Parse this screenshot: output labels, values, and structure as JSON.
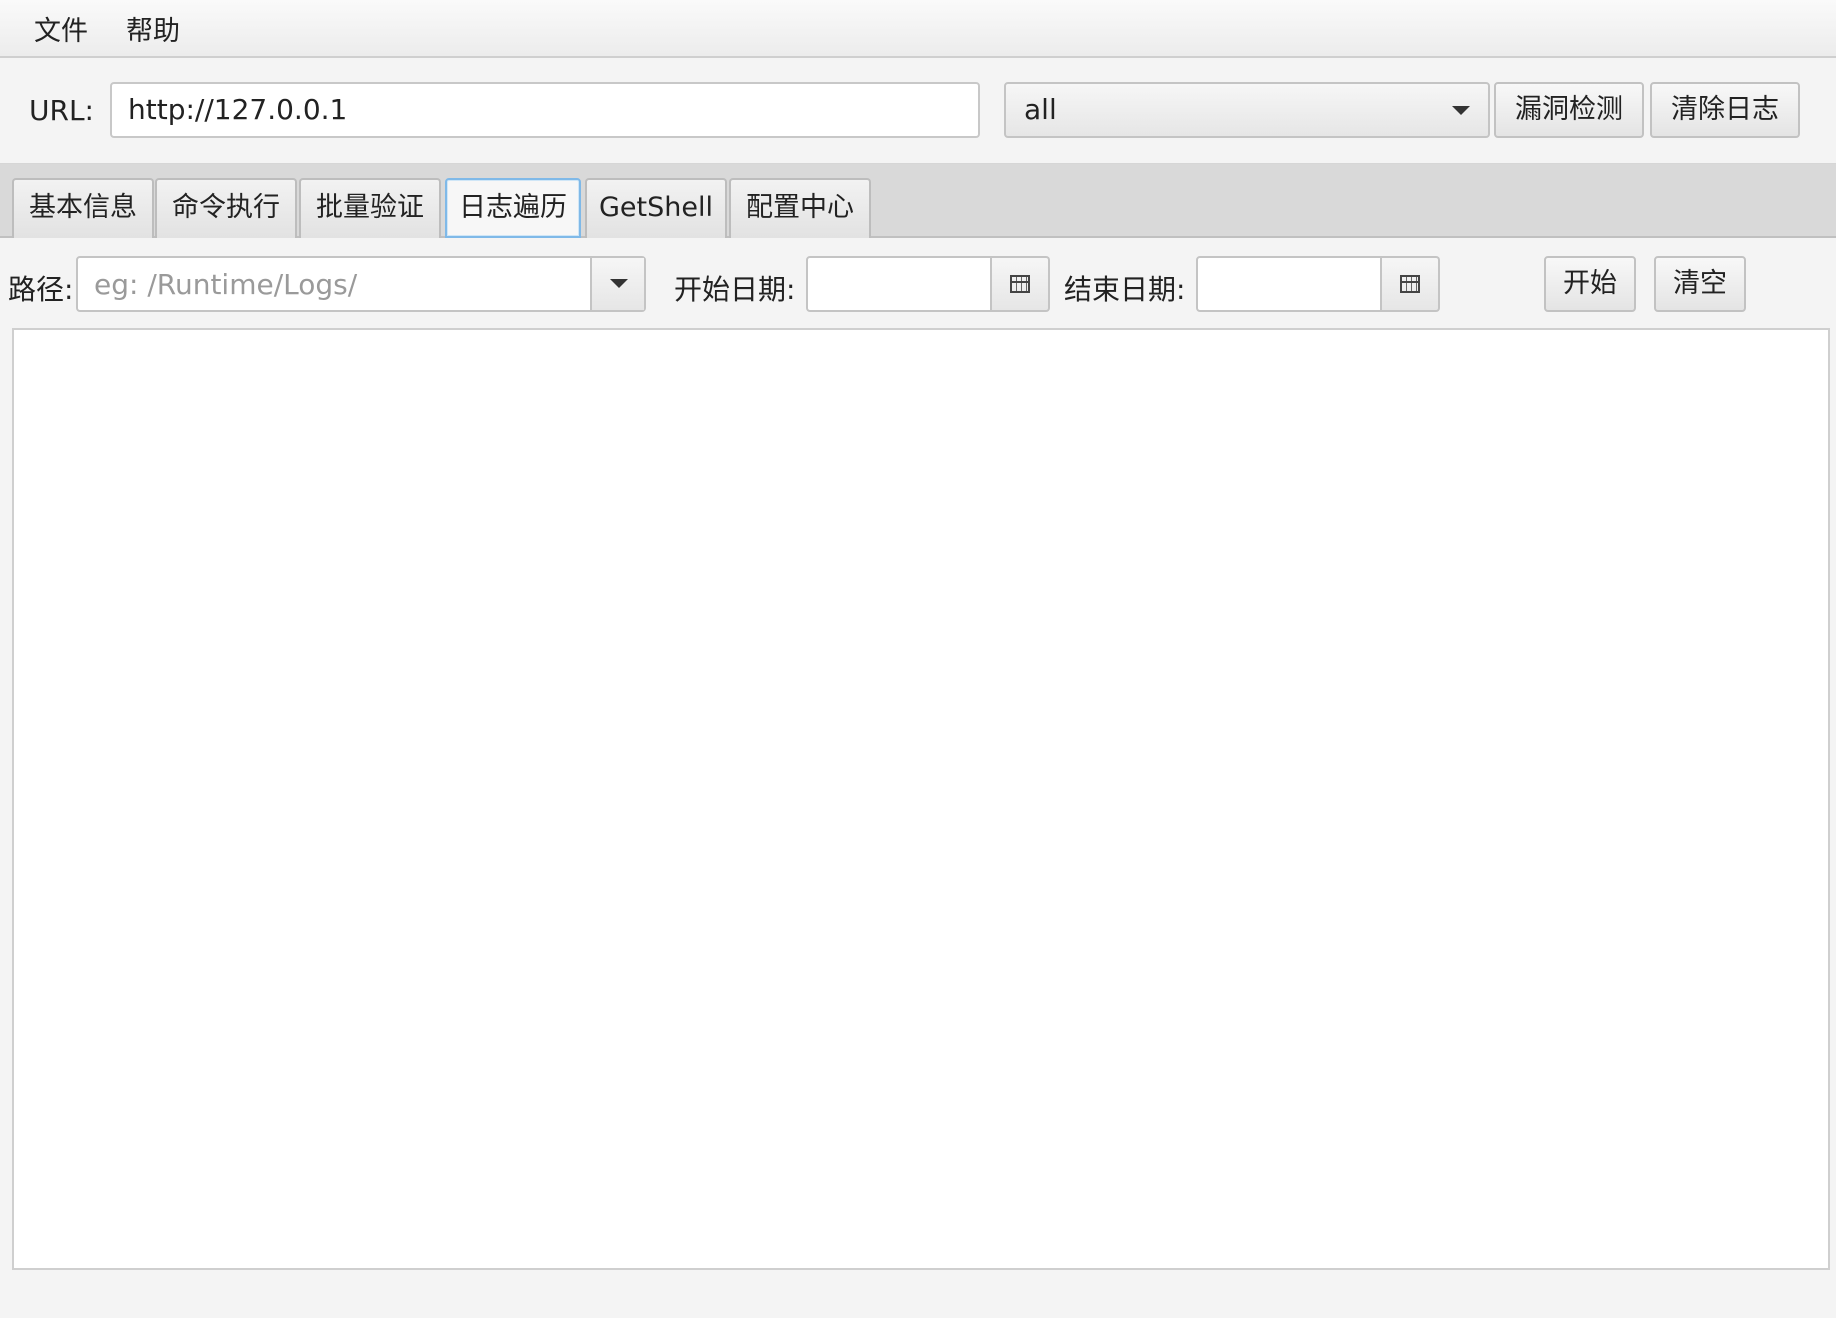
{
  "menu": [
    "文件",
    "帮助"
  ],
  "toolbar": {
    "url_label": "URL:",
    "url_value": "http://127.0.0.1",
    "combo_value": "all",
    "detect_button": "漏洞检测",
    "clear_log_button": "清除日志"
  },
  "tabs": [
    {
      "label": "基本信息"
    },
    {
      "label": "命令执行"
    },
    {
      "label": "批量验证"
    },
    {
      "label": "日志遍历",
      "active": true
    },
    {
      "label": "GetShell"
    },
    {
      "label": "配置中心"
    }
  ],
  "log_panel": {
    "path_label": "路径:",
    "path_placeholder": "eg: /Runtime/Logs/",
    "start_date_label": "开始日期:",
    "end_date_label": "结束日期:",
    "start_button": "开始",
    "clear_button": "清空"
  },
  "colors": {
    "active_tab_border": "#7fb9e8",
    "background": "#f4f4f4"
  }
}
